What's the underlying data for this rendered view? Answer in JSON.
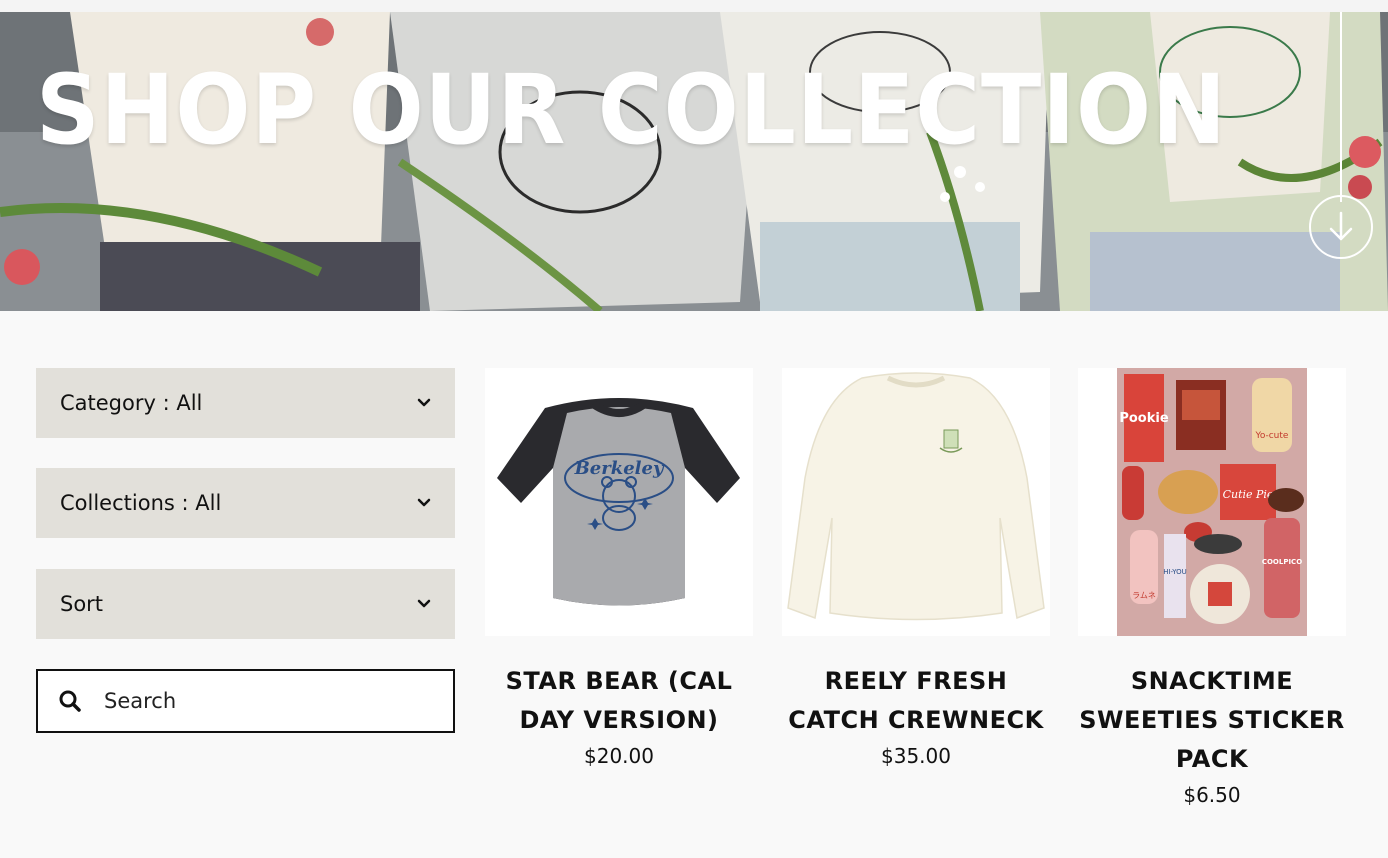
{
  "hero": {
    "title": "SHOP OUR COLLECTION"
  },
  "filters": [
    {
      "label": "Category : All"
    },
    {
      "label": "Collections : All"
    },
    {
      "label": "Sort"
    }
  ],
  "search": {
    "placeholder": "Search"
  },
  "products": [
    {
      "name": "STAR BEAR (CAL DAY VERSION)",
      "price": "$20.00",
      "image_text": "Berkeley"
    },
    {
      "name": "REELY FRESH CATCH CREWNECK",
      "price": "$35.00"
    },
    {
      "name": "SNACKTIME SWEETIES STICKER PACK",
      "price": "$6.50",
      "image_text": [
        "Pookie",
        "Yo-cute",
        "Cutie Pie",
        "COOLPICO",
        "HI-YOU",
        "ラムネ"
      ]
    }
  ],
  "icons": {
    "scroll_down": "arrow-down-circle-icon",
    "dropdown": "chevron-down-icon",
    "search": "search-icon"
  },
  "colors": {
    "background": "#f9f9f9",
    "filter_bg": "#e2e0da",
    "text": "#111111"
  }
}
